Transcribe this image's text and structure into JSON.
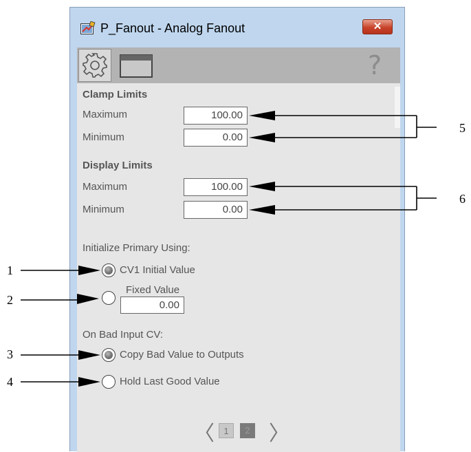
{
  "window": {
    "title": "P_Fanout - Analog Fanout",
    "close_symbol": "✕"
  },
  "toolbar": {
    "help_symbol": "?"
  },
  "clamp_limits": {
    "title": "Clamp Limits",
    "maximum_label": "Maximum",
    "maximum_value": "100.00",
    "minimum_label": "Minimum",
    "minimum_value": "0.00"
  },
  "display_limits": {
    "title": "Display Limits",
    "maximum_label": "Maximum",
    "maximum_value": "100.00",
    "minimum_label": "Minimum",
    "minimum_value": "0.00"
  },
  "initialize": {
    "heading": "Initialize Primary Using:",
    "option1_label": "CV1 Initial Value",
    "option1_selected": true,
    "option2_label": "Fixed Value",
    "option2_selected": false,
    "fixed_value": "0.00"
  },
  "bad_input": {
    "heading": "On Bad Input CV:",
    "option1_label": "Copy Bad Value to Outputs",
    "option1_selected": true,
    "option2_label": "Hold Last Good Value",
    "option2_selected": false
  },
  "pager": {
    "prev_symbol": "〈",
    "next_symbol": "〉",
    "page1": "1",
    "page2": "2",
    "current_page": 2
  },
  "callouts": {
    "c1": "1",
    "c2": "2",
    "c3": "3",
    "c4": "4",
    "c5": "5",
    "c6": "6"
  },
  "icons": [
    "app-icon",
    "close-icon",
    "gear-icon",
    "panel-icon",
    "help-icon",
    "chevron-left-icon",
    "chevron-right-icon"
  ],
  "colors": {
    "window_frame": "#bfd6ee",
    "content_bg": "#e6e6e6",
    "toolbar_bg": "#b3b3b3",
    "close_red": "#c7432a"
  }
}
